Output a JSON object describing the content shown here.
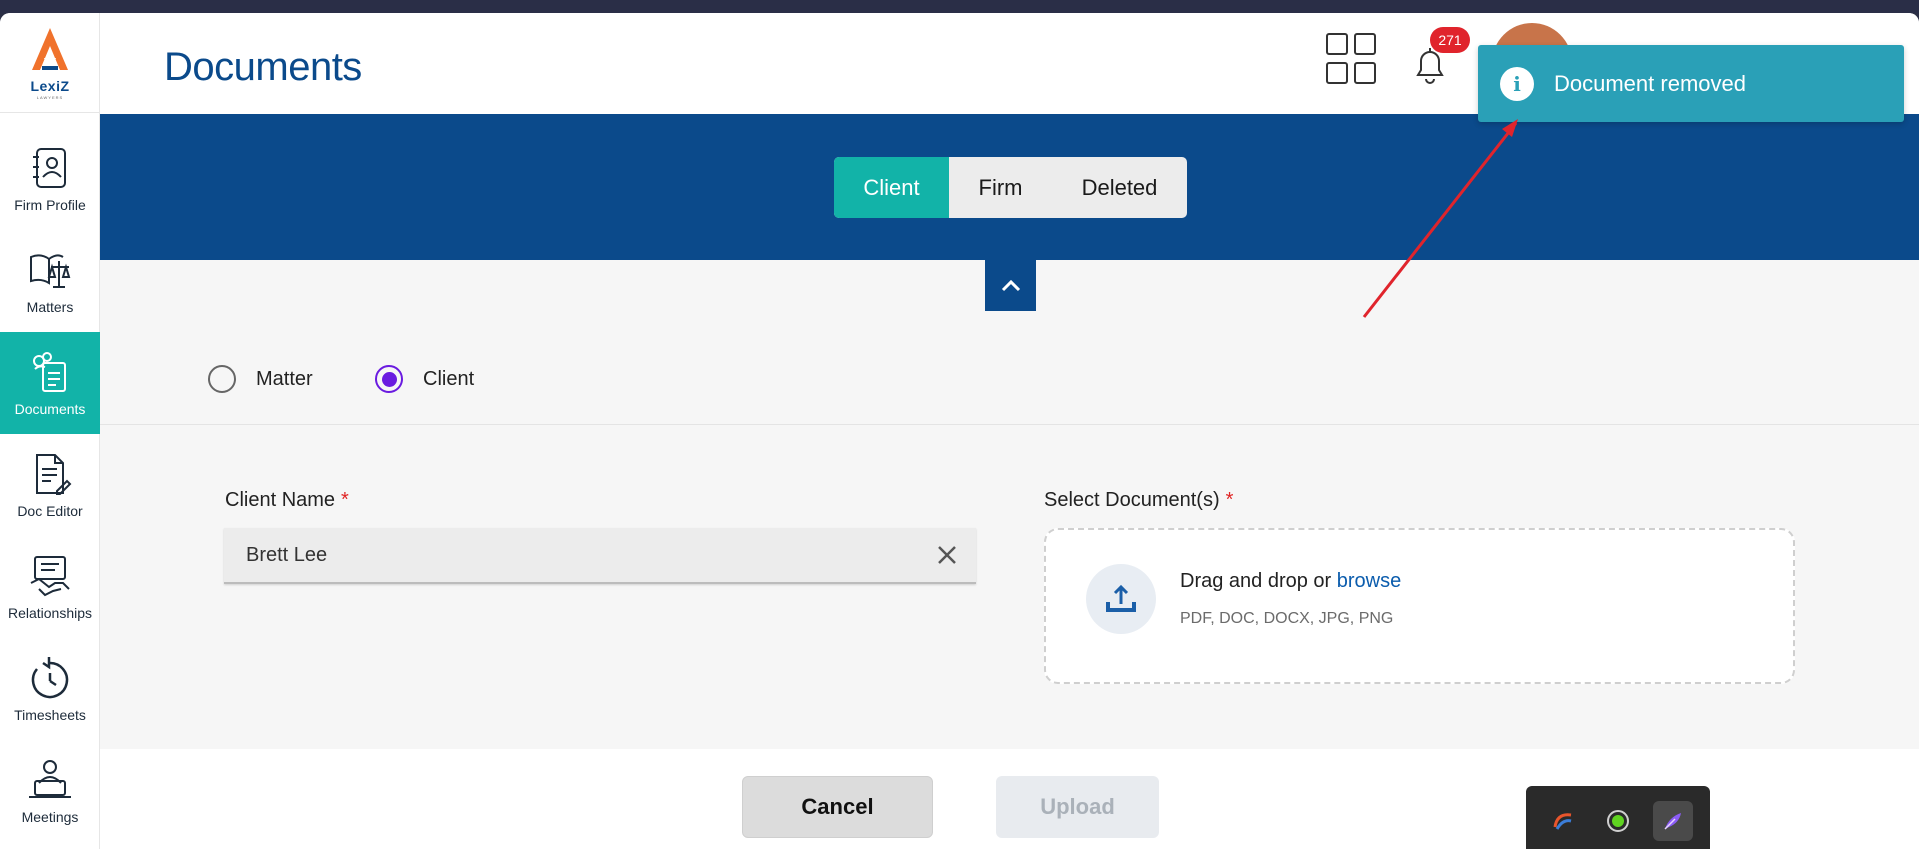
{
  "app": {
    "brand": "LexiZ",
    "brand_sub": "LAWYERS"
  },
  "sidebar": {
    "items": [
      {
        "label": "Firm Profile",
        "icon": "address-book-icon"
      },
      {
        "label": "Matters",
        "icon": "scales-book-icon"
      },
      {
        "label": "Documents",
        "icon": "documents-icon",
        "active": true
      },
      {
        "label": "Doc Editor",
        "icon": "doc-edit-icon"
      },
      {
        "label": "Relationships",
        "icon": "handshake-icon"
      },
      {
        "label": "Timesheets",
        "icon": "stopwatch-icon"
      },
      {
        "label": "Meetings",
        "icon": "meeting-icon"
      }
    ]
  },
  "header": {
    "title": "Documents",
    "notification_count": "271"
  },
  "tabs": [
    {
      "label": "Client",
      "active": true
    },
    {
      "label": "Firm"
    },
    {
      "label": "Deleted"
    }
  ],
  "radio": {
    "options": [
      {
        "label": "Matter",
        "checked": false
      },
      {
        "label": "Client",
        "checked": true
      }
    ]
  },
  "form": {
    "client_name_label": "Client Name",
    "required_mark": "*",
    "client_name_value": "Brett Lee",
    "select_docs_label": "Select Document(s)",
    "dropzone_text": "Drag and drop or",
    "dropzone_link": "browse",
    "dropzone_types": "PDF, DOC, DOCX, JPG, PNG"
  },
  "footer": {
    "cancel_label": "Cancel",
    "upload_label": "Upload"
  },
  "toast": {
    "message": "Document removed",
    "icon": "info-icon"
  },
  "colors": {
    "primary": "#0b4a8b",
    "accent": "#12b3a8",
    "toast": "#2aa0b7",
    "radio": "#6a1be0",
    "badge": "#e0242c"
  }
}
